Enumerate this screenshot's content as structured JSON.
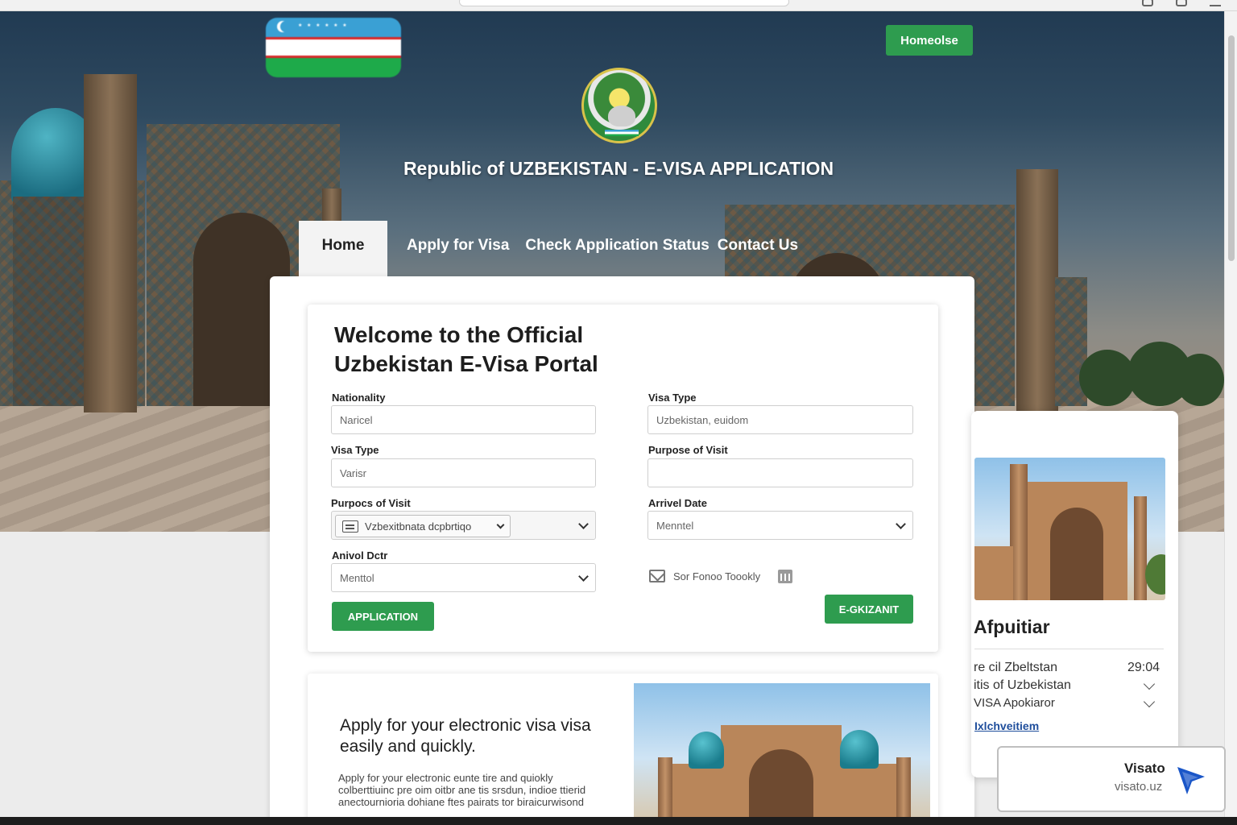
{
  "header": {
    "title": "Republic of UZBEKISTAN - E-VISA APPLICATION",
    "top_button": "Homeolse"
  },
  "nav": {
    "tabs": [
      {
        "label": "Home",
        "active": true
      },
      {
        "label": "Apply for Visa",
        "active": false
      },
      {
        "label": "Check Application Status",
        "active": false
      },
      {
        "label": "Contact Us",
        "active": false
      }
    ]
  },
  "form": {
    "heading": "Welcome to the Official Uzbekistan E-Visa Portal",
    "fields": {
      "nationality": {
        "label": "Nationality",
        "value": "Naricel"
      },
      "visa_type_right": {
        "label": "Visa Type",
        "value": "Uzbekistan, euidom"
      },
      "visa_type": {
        "label": "Visa Type",
        "value": "Varisr"
      },
      "purpose_right": {
        "label": "Purpose of Visit",
        "value": ""
      },
      "purpose": {
        "label": "Purpocs of Visit",
        "value": "Vzbexitbnata dcpbrtiqo"
      },
      "arrival_right": {
        "label": "Arrivel Date",
        "value": "Menntel"
      },
      "arrival": {
        "label": "Anivol Dctr",
        "value": "Menttol"
      }
    },
    "option_text": "Sor Fonoo Toookly",
    "application_button": "APPLICATION",
    "submit_button": "E-GKIZANIT"
  },
  "info": {
    "title": "Apply for your electronic visa visa easily and quickly.",
    "body": "Apply for your electronic eunte tire and quiokly colberttiuinc pre oim oitbr ane tis srsdun, indioe ttierid anectournioria dohiane ftes pairats tor biraicurwisond"
  },
  "side": {
    "title": "Afpuitiar",
    "rows": [
      {
        "text": "re cil Zbeltstan",
        "value": "29:04"
      },
      {
        "text": "itis of Uzbekistan"
      },
      {
        "text": "VISA Apokiaror"
      }
    ],
    "link": "Ixlchveitiem"
  },
  "toast": {
    "name": "Visato",
    "url": "visato.uz",
    "accent": "#1a56c8"
  },
  "colors": {
    "accent_green": "#2e9c4f",
    "hero_sky": "#213a52"
  },
  "icons": {
    "mail": "mail-icon",
    "calendar": "calendar-icon",
    "list": "list-icon",
    "chevron": "chevron-down-icon",
    "cursor": "cursor-arrow-icon"
  }
}
